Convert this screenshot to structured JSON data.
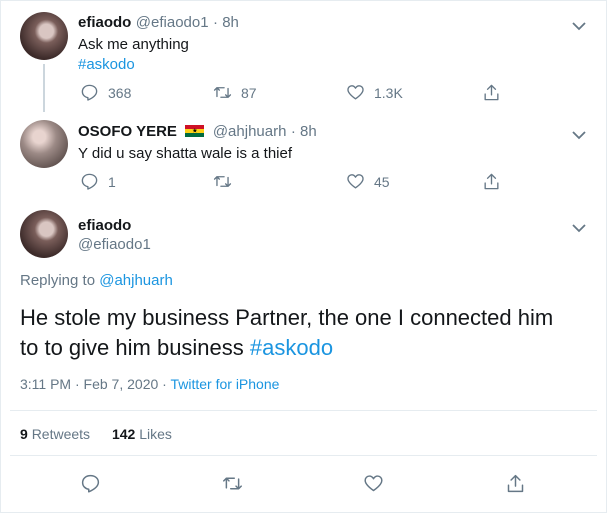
{
  "tweet1": {
    "name": "efiaodo",
    "handle": "@efiaodo1",
    "time": "· 8h",
    "text": "Ask me anything",
    "hashtag": "#askodo",
    "replies": "368",
    "retweets": "87",
    "likes": "1.3K"
  },
  "tweet2": {
    "name": "OSOFO YERE",
    "handle": "@ahjhuarh",
    "time": "· 8h",
    "text": "Y did u say shatta wale is a thief",
    "replies": "1",
    "retweets": "",
    "likes": "45"
  },
  "main": {
    "name": "efiaodo",
    "handle": "@efiaodo1",
    "replying_label": "Replying to",
    "replying_handle": "@ahjhuarh",
    "text_line1": "He stole my business Partner, the one I connected him",
    "text_line2_pre": "to to give him business",
    "hashtag": "#askodo",
    "timestamp": "3:11 PM · Feb 7, 2020 ·",
    "source": "Twitter for iPhone",
    "retweets_count": "9",
    "retweets_label": "Retweets",
    "likes_count": "142",
    "likes_label": "Likes"
  },
  "colors": {
    "accent": "#1b95e0",
    "muted": "#657786",
    "border": "#e6ecf0",
    "thread": "#ccd6dd"
  },
  "icons": [
    "reply-icon",
    "retweet-icon",
    "like-icon",
    "share-icon",
    "chevron-down-icon",
    "ghana-flag-icon"
  ]
}
